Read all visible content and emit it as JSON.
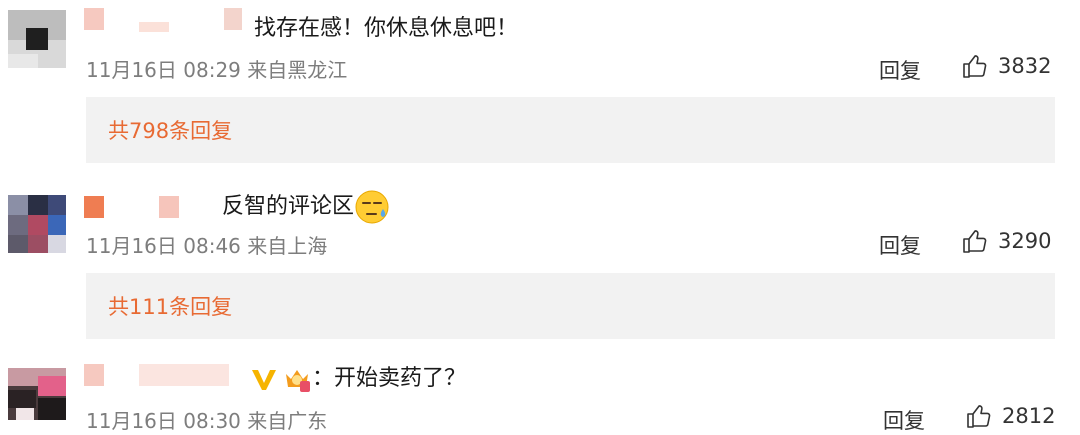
{
  "comments": [
    {
      "text": "找存在感！你休息休息吧！",
      "time": "11月16日 08:29",
      "location": "来自黑龙江",
      "reply_label": "回复",
      "likes": "3832",
      "replies_link": "共798条回复"
    },
    {
      "text": "反智的评论区",
      "time": "11月16日 08:46",
      "location": "来自上海",
      "reply_label": "回复",
      "likes": "3290",
      "replies_link": "共111条回复"
    },
    {
      "text": "：开始卖药了？",
      "time": "11月16日 08:30",
      "location": "来自广东",
      "reply_label": "回复",
      "likes": "2812"
    }
  ],
  "icons": {
    "like": "thumbs-up-icon",
    "emoji": "sweat-face-emoji-icon",
    "badge": "crown-badge-icon",
    "vip": "vip-v-icon"
  },
  "colors": {
    "accent": "#e86a33",
    "meta": "#7d7d7d",
    "panel": "#f2f2f2"
  }
}
